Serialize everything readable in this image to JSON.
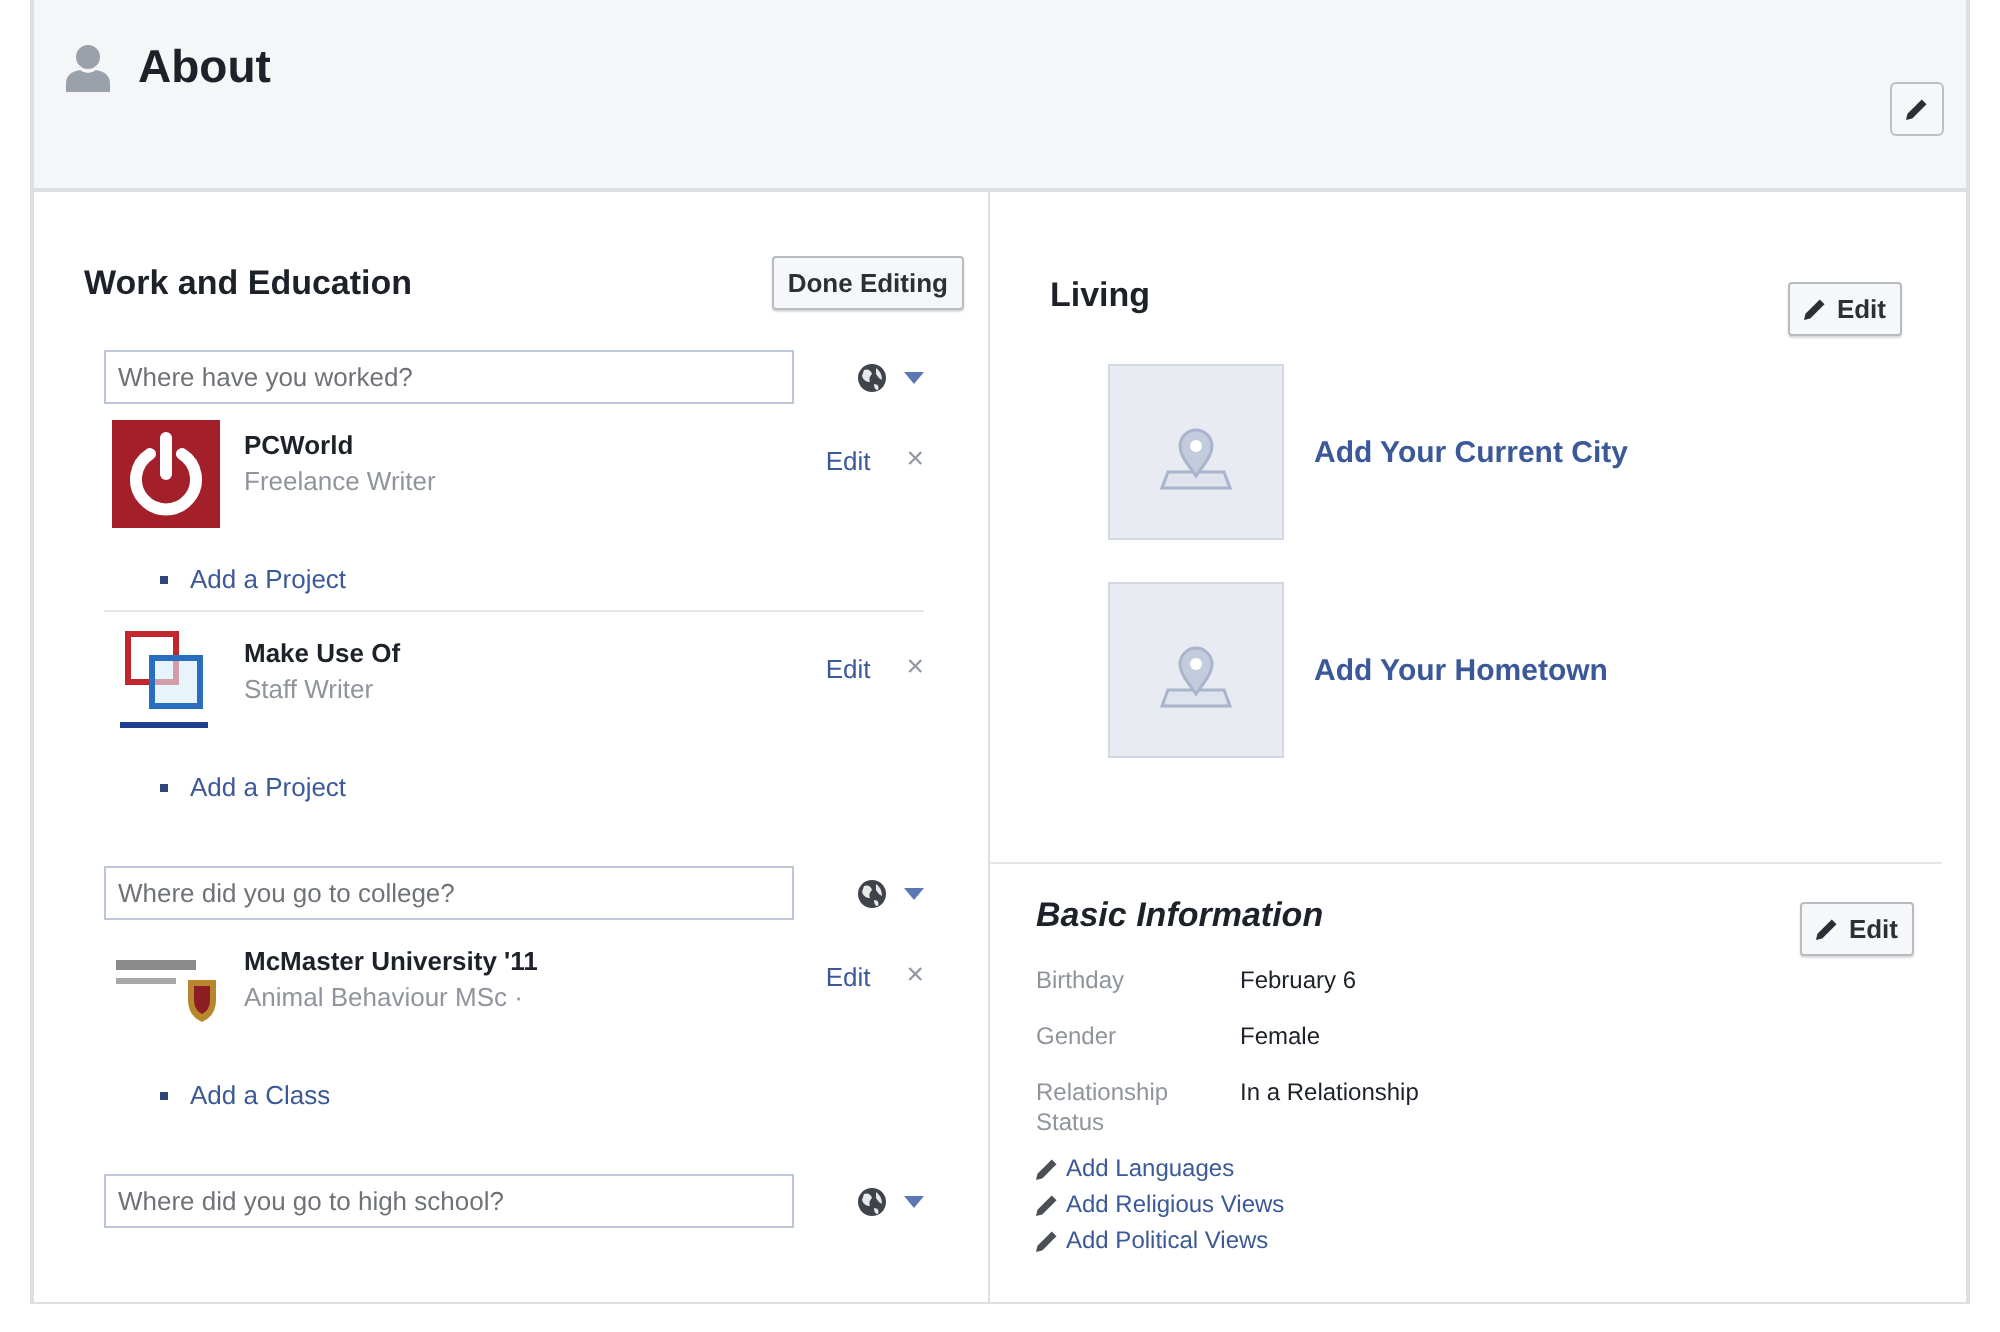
{
  "header": {
    "title": "About"
  },
  "work_and_education": {
    "title": "Work and Education",
    "done_button": "Done Editing",
    "groups": [
      {
        "placeholder": "Where have you worked?",
        "entries": [
          {
            "kind": "power",
            "name": "PCWorld",
            "detail": "Freelance Writer",
            "edit": "Edit",
            "remove": "×",
            "add_link": "Add a Project"
          },
          {
            "kind": "squares",
            "name": "Make Use Of",
            "detail": "Staff Writer",
            "edit": "Edit",
            "remove": "×",
            "add_link": "Add a Project"
          }
        ]
      },
      {
        "placeholder": "Where did you go to college?",
        "entries": [
          {
            "kind": "crest",
            "name": "McMaster University '11",
            "detail": "Animal Behaviour MSc ·",
            "edit": "Edit",
            "remove": "×",
            "add_link": "Add a Class"
          }
        ]
      },
      {
        "placeholder": "Where did you go to high school?"
      }
    ]
  },
  "living": {
    "title": "Living",
    "edit_button": "Edit",
    "items": [
      {
        "label": "Add Your Current City"
      },
      {
        "label": "Add Your Hometown"
      }
    ]
  },
  "basic_information": {
    "title": "Basic Information",
    "edit_button": "Edit",
    "fields": [
      {
        "label": "Birthday",
        "value": "February 6"
      },
      {
        "label": "Gender",
        "value": "Female"
      },
      {
        "label": "Relationship Status",
        "value": "In a Relationship"
      }
    ],
    "links": [
      "Add Languages",
      "Add Religious Views",
      "Add Political Views"
    ]
  }
}
